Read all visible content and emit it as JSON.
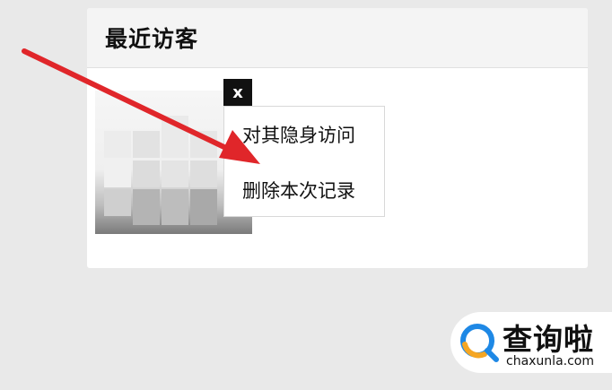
{
  "panel": {
    "title": "最近访客"
  },
  "visitor": {
    "close_label": "x",
    "menu": [
      {
        "label": "对其隐身访问"
      },
      {
        "label": "删除本次记录"
      }
    ]
  },
  "annotation": {
    "arrow_color": "#e0262a"
  },
  "watermark": {
    "title": "查询啦",
    "subtitle": "chaxunla.com",
    "logo_colors": [
      "#1e88e5",
      "#f5a623"
    ]
  }
}
